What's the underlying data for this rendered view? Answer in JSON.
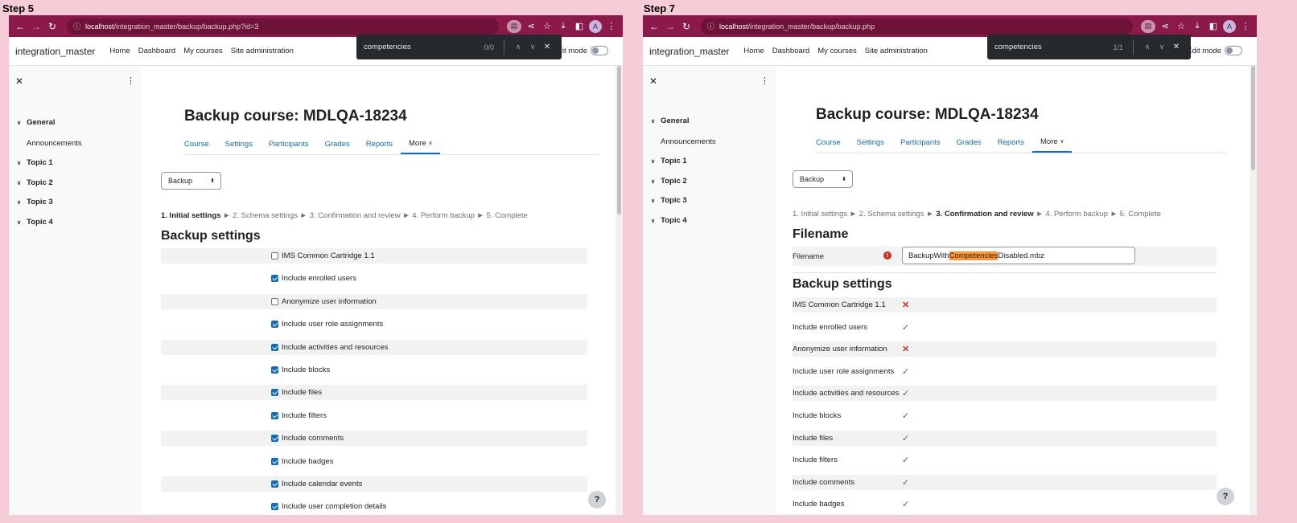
{
  "steps": {
    "left_label": "Step 5",
    "right_label": "Step 7"
  },
  "left": {
    "url_host": "localhost",
    "url_path": "/integration_master/backup/backup.php?id=3",
    "find_query": "competencies",
    "find_count": "0/0",
    "brand": "integration_master",
    "nav": [
      "Home",
      "Dashboard",
      "My courses",
      "Site administration"
    ],
    "edit_mode": "Edit mode",
    "drawer": {
      "sections": [
        "General",
        "Topic 1",
        "Topic 2",
        "Topic 3",
        "Topic 4"
      ],
      "general_child": "Announcements"
    },
    "course_title": "Backup course: MDLQA-18234",
    "tabs": [
      "Course",
      "Settings",
      "Participants",
      "Grades",
      "Reports",
      "More"
    ],
    "select_value": "Backup",
    "progress": {
      "current": "1. Initial settings",
      "rest": "► 2. Schema settings ► 3. Confirmation and review ► 4. Perform backup ► 5. Complete"
    },
    "settings_heading": "Backup settings",
    "settings": [
      {
        "label": "IMS Common Cartridge 1.1",
        "checked": false
      },
      {
        "label": "Include enrolled users",
        "checked": true
      },
      {
        "label": "Anonymize user information",
        "checked": false
      },
      {
        "label": "Include user role assignments",
        "checked": true
      },
      {
        "label": "Include activities and resources",
        "checked": true
      },
      {
        "label": "Include blocks",
        "checked": true
      },
      {
        "label": "Include files",
        "checked": true
      },
      {
        "label": "Include filters",
        "checked": true
      },
      {
        "label": "Include comments",
        "checked": true
      },
      {
        "label": "Include badges",
        "checked": true
      },
      {
        "label": "Include calendar events",
        "checked": true
      },
      {
        "label": "Include user completion details",
        "checked": true
      }
    ],
    "help": "?"
  },
  "right": {
    "url_host": "localhost",
    "url_path": "/integration_master/backup/backup.php",
    "find_query": "competencies",
    "find_count": "1/1",
    "brand": "integration_master",
    "nav": [
      "Home",
      "Dashboard",
      "My courses",
      "Site administration"
    ],
    "edit_mode": "Edit mode",
    "drawer": {
      "sections": [
        "General",
        "Topic 1",
        "Topic 2",
        "Topic 3",
        "Topic 4"
      ],
      "general_child": "Announcements"
    },
    "course_title": "Backup course: MDLQA-18234",
    "tabs": [
      "Course",
      "Settings",
      "Participants",
      "Grades",
      "Reports",
      "More"
    ],
    "select_value": "Backup",
    "progress": {
      "before": "1. Initial settings ► 2. Schema settings ►",
      "current": "3. Confirmation and review",
      "after": "► 4. Perform backup ► 5. Complete"
    },
    "filename_heading": "Filename",
    "filename_label": "Filename",
    "filename_parts": {
      "pre": "BackupWith",
      "match": "Competencies",
      "post": "Disabled.mbz"
    },
    "settings_heading": "Backup settings",
    "settings": [
      {
        "label": "IMS Common Cartridge 1.1",
        "enabled": false
      },
      {
        "label": "Include enrolled users",
        "enabled": true
      },
      {
        "label": "Anonymize user information",
        "enabled": false
      },
      {
        "label": "Include user role assignments",
        "enabled": true
      },
      {
        "label": "Include activities and resources",
        "enabled": true
      },
      {
        "label": "Include blocks",
        "enabled": true
      },
      {
        "label": "Include files",
        "enabled": true
      },
      {
        "label": "Include filters",
        "enabled": true
      },
      {
        "label": "Include comments",
        "enabled": true
      },
      {
        "label": "Include badges",
        "enabled": true
      }
    ],
    "help": "?"
  },
  "icons": {
    "back": "←",
    "forward": "→",
    "reload": "↻",
    "info": "ⓘ",
    "doc": "▤",
    "share": "⋖",
    "star": "☆",
    "download": "⤓",
    "sidepanel": "◧",
    "avatar": "A",
    "menu": "⋮",
    "close": "✕",
    "kebab": "⋮",
    "chevron": "∨",
    "up": "∧",
    "down": "∨",
    "check": "✓",
    "cross": "✕",
    "error": "!"
  },
  "colors": {
    "chrome": "#8b1a4a",
    "link": "#0f6cbf",
    "ok": "#357a32",
    "error": "#ca3120",
    "highlight": "#ff9632"
  }
}
